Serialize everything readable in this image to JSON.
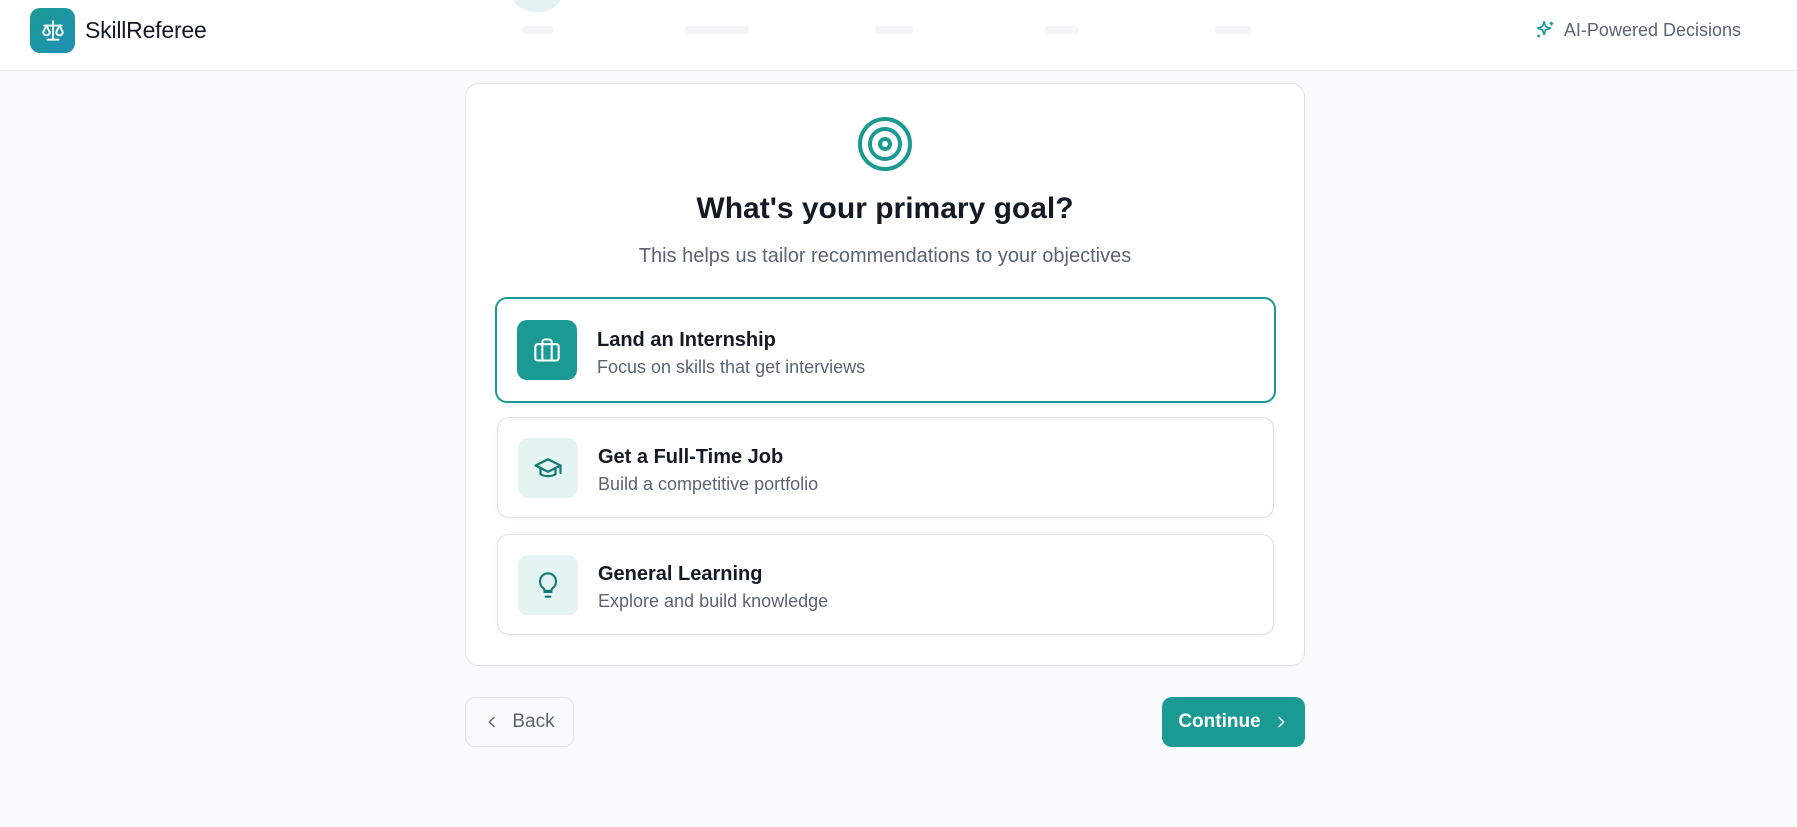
{
  "header": {
    "brand": "SkillReferee",
    "badge": "AI-Powered Decisions"
  },
  "question": {
    "title": "What's your primary goal?",
    "subtitle": "This helps us tailor recommendations to your objectives"
  },
  "options": [
    {
      "title": "Land an Internship",
      "description": "Focus on skills that get interviews",
      "icon": "briefcase-icon",
      "selected": true
    },
    {
      "title": "Get a Full-Time Job",
      "description": "Build a competitive portfolio",
      "icon": "graduation-cap-icon",
      "selected": false
    },
    {
      "title": "General Learning",
      "description": "Explore and build knowledge",
      "icon": "lightbulb-icon",
      "selected": false
    }
  ],
  "nav": {
    "back_label": "Back",
    "continue_label": "Continue"
  },
  "colors": {
    "accent": "#1a9a92",
    "accent_light": "#e3f4f2",
    "text": "#141a24",
    "muted": "#5b6475"
  }
}
